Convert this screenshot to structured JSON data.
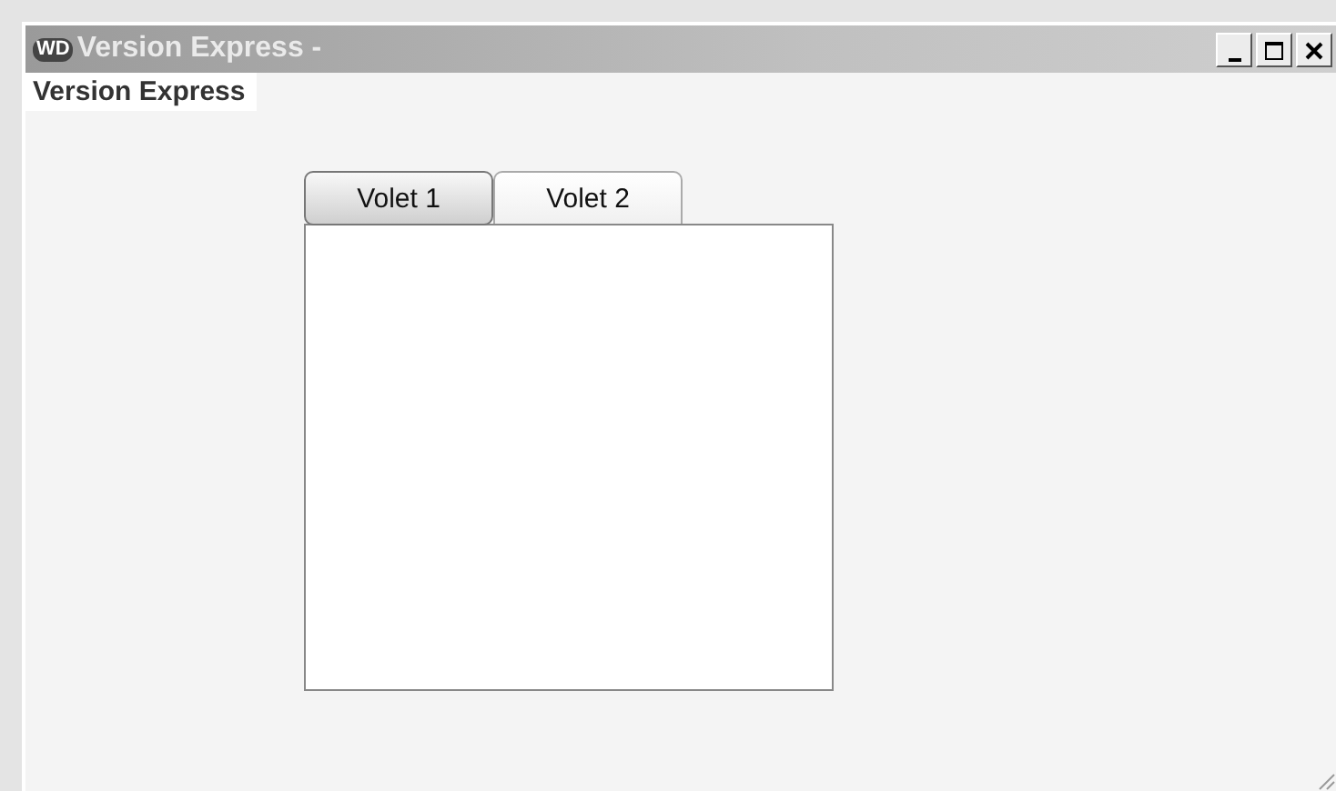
{
  "window": {
    "logo": "WD",
    "title": "Version Express -"
  },
  "label": "Version Express",
  "tabs": [
    {
      "label": "Volet 1",
      "selected": true
    },
    {
      "label": "Volet 2",
      "selected": false
    }
  ]
}
